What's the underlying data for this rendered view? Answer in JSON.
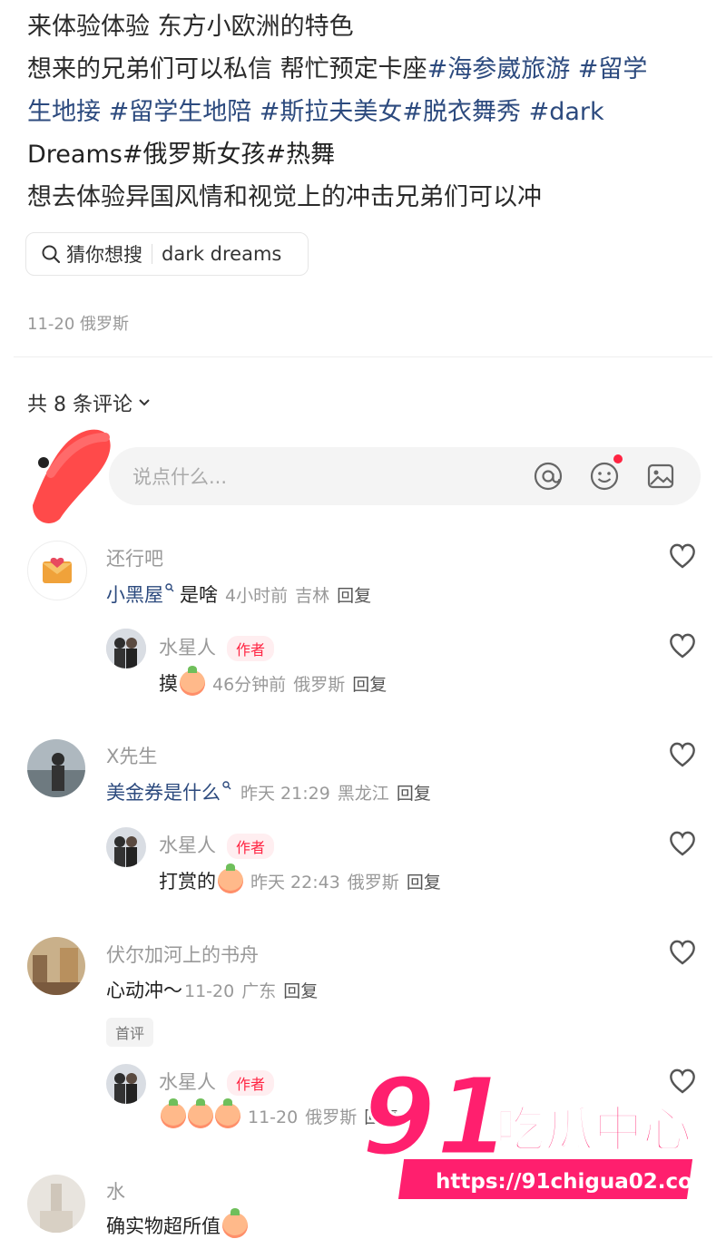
{
  "post": {
    "line1": "来体验体验 东方小欧洲的特色",
    "line2_text": "想来的兄弟们可以私信 帮忙预定卡座",
    "line2_tag1": "#海参崴旅游",
    "line2_tag2": " #留学",
    "line3_tags": "生地接 #留学生地陪 #斯拉夫美女#脱衣舞秀 #dark",
    "line4_tags": "Dreams#俄罗斯女孩#热舞",
    "line5": "想去体验异国风情和视觉上的冲击兄弟们可以冲"
  },
  "search_chip": {
    "label": "猜你想搜",
    "query": "dark dreams"
  },
  "meta": "11-20 俄罗斯",
  "comments_count": "共 8 条评论",
  "input": {
    "placeholder": "说点什么..."
  },
  "comments": [
    {
      "user": "还行吧",
      "text_hl": "小黑屋",
      "text": "是啥",
      "time": "4小时前",
      "loc": "吉林",
      "reply": "回复",
      "sub": {
        "user": "水星人",
        "badge": "作者",
        "text": "摸",
        "time": "46分钟前",
        "loc": "俄罗斯",
        "reply": "回复"
      }
    },
    {
      "user": "X先生",
      "text_hl": "美金券是什么",
      "text": "",
      "time": "昨天 21:29",
      "loc": "黑龙江",
      "reply": "回复",
      "sub": {
        "user": "水星人",
        "badge": "作者",
        "text": "打赏的",
        "time": "昨天 22:43",
        "loc": "俄罗斯",
        "reply": "回复"
      }
    },
    {
      "user": "伏尔加河上的书舟",
      "text": "心动冲～",
      "time": "11-20",
      "loc": "广东",
      "reply": "回复",
      "badge": "首评",
      "sub": {
        "user": "水星人",
        "badge": "作者",
        "time": "11-20",
        "loc": "俄罗斯",
        "reply": "回复"
      }
    },
    {
      "user": "水",
      "text": "确实物超所值"
    }
  ],
  "watermark": {
    "brand_num": "91",
    "brand_text": "吃瓜中心",
    "url": "https://91chigua02.com"
  },
  "colors": {
    "accent": "#ff2442",
    "tag": "#2c4a7e",
    "muted": "#999999"
  }
}
